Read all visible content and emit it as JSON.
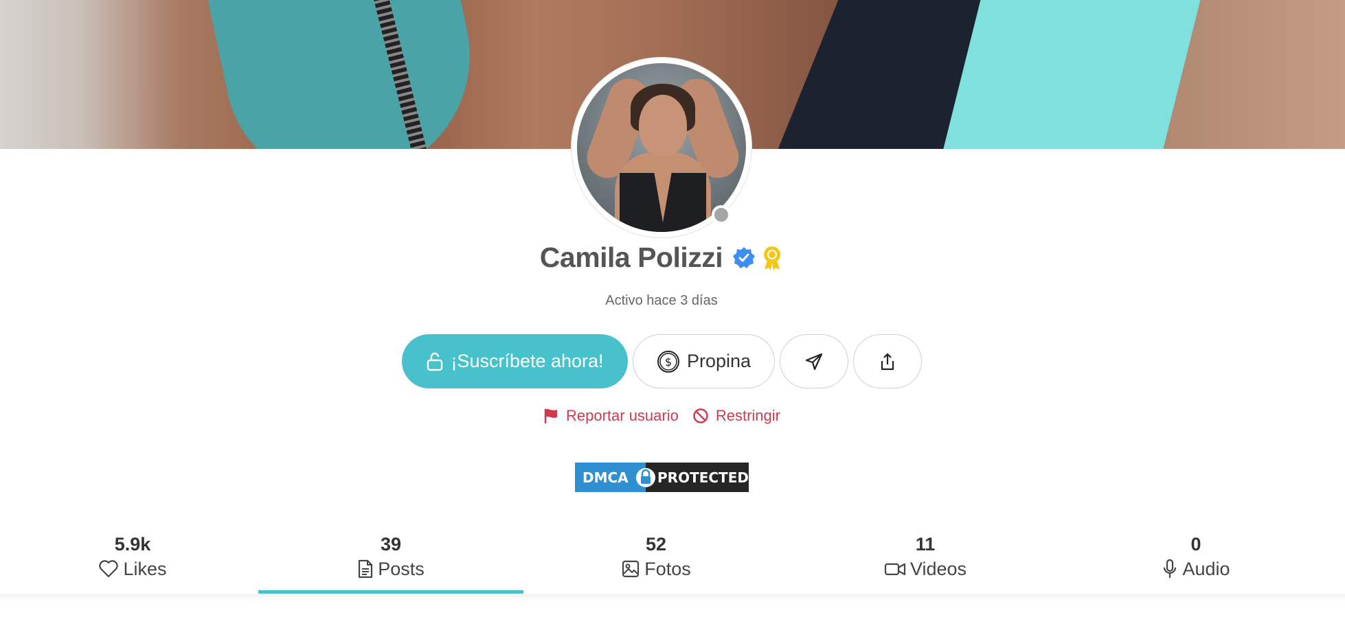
{
  "profile": {
    "name": "Camila Polizzi",
    "status": "Activo hace 3 días",
    "online_status_color": "#a5a5a5",
    "badges": [
      "verified-badge-icon",
      "award-badge-icon"
    ]
  },
  "actions": {
    "subscribe_label": "¡Suscríbete ahora!",
    "tip_label": "Propina",
    "send_icon": "paper-plane-icon",
    "share_icon": "share-icon"
  },
  "links": {
    "report_label": "Reportar usuario",
    "restrict_label": "Restringir"
  },
  "dmca": {
    "left": "DMCA",
    "right": "PROTECTED"
  },
  "stats": [
    {
      "count": "5.9k",
      "label": "Likes",
      "icon": "heart-icon"
    },
    {
      "count": "39",
      "label": "Posts",
      "icon": "document-icon",
      "active": true
    },
    {
      "count": "52",
      "label": "Fotos",
      "icon": "image-icon"
    },
    {
      "count": "11",
      "label": "Videos",
      "icon": "video-icon"
    },
    {
      "count": "0",
      "label": "Audio",
      "icon": "microphone-icon"
    }
  ],
  "colors": {
    "accent": "#47c2cc",
    "danger": "#d03a4e",
    "verified": "#3d8ef0",
    "award": "#f5c518"
  }
}
